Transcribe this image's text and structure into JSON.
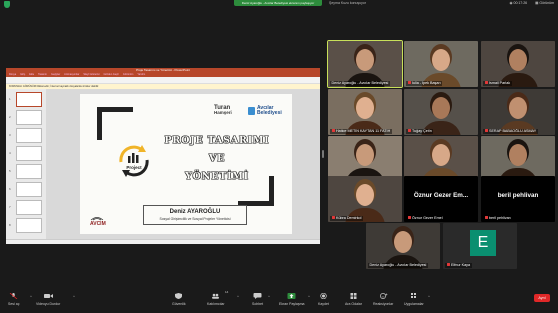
{
  "topbar": {
    "share_banner": "Deniz Ayaroğlu - Avcılar Belediyesi ekranını paylaşıyor",
    "speaking": "Şeyma Kuzu konuşuyor",
    "recording_time": "00:17:26",
    "view_label": "Görünüm"
  },
  "powerpoint": {
    "window_title": "Proje Tasarımı ve Yönetimi - PowerPoint",
    "tabs": [
      "Dosya",
      "Giriş",
      "Ekle",
      "Tasarım",
      "Geçişler",
      "Animasyonlar",
      "Slayt Gösterisi",
      "Gözden Geçir",
      "Görünüm",
      "Yardım"
    ],
    "warning": "KORUMALI GÖRÜNÜM Dikkat edin; İnternet kaynaklı dosyalarda virüsler olabilir.",
    "slide_numbers": [
      "1",
      "2",
      "3",
      "4",
      "5",
      "6",
      "7",
      "8"
    ]
  },
  "slide": {
    "title_lines": [
      "PROJE TASARIMI",
      "VE",
      "YÖNETİMİ"
    ],
    "logo_text": "Project",
    "partner_logo_turan": [
      "Turan",
      "Hamşeri"
    ],
    "partner_logo_avcilar": [
      "Avcılar",
      "Belediyesi"
    ],
    "presenter_name": "Deniz AYAROĞLU",
    "presenter_role": "Sosyal Girişimcilik ve Sosyal Projeler Yöneticisi",
    "org_logo": "AVCIM"
  },
  "gallery": {
    "participants": [
      {
        "name": "Deniz Ayaroğlu - Avcılar Belediyesi",
        "muted": false,
        "active": true
      },
      {
        "name": "Iulia - İpek Başarı",
        "muted": true
      },
      {
        "name": "İsmail Parlak",
        "muted": true
      },
      {
        "name": "Hatice METİN KAYTAN 11 FATİH",
        "muted": true
      },
      {
        "name": "Tuğay Çetin",
        "muted": true
      },
      {
        "name": "SERAP BABAOĞLU ASMAY",
        "muted": true
      },
      {
        "name": "Melissa Karagöz",
        "muted": true
      },
      {
        "name": "esra akgün",
        "muted": true
      },
      {
        "name": "Aysel Öz",
        "muted": true
      },
      {
        "name": "Kübra Demirkol",
        "muted": true
      },
      {
        "name": "Öznur Gezer Emel",
        "muted": true,
        "display_name": "Öznur Gezer Em..."
      },
      {
        "name": "beril pehlivan",
        "muted": true,
        "display_name": "beril pehlivan"
      },
      {
        "name": "Deniz Ayaroğlu - Avcılar Belediyesi",
        "muted": false
      },
      {
        "name": "Elfnur Kaya",
        "muted": true,
        "avatar_letter": "E"
      }
    ]
  },
  "toolbar": {
    "mute": "Sesi aç",
    "video": "Videoyu Durdur",
    "security": "Güvenlik",
    "participants": "Katılımcılar",
    "participants_count": "14",
    "chat": "Sohbet",
    "share": "Ekran Paylaşma",
    "record": "Kaydet",
    "breakout": "Ara Odalar",
    "reactions": "Reaksiyonlar",
    "apps": "Uygulamalar",
    "leave": "Ayrıl"
  },
  "colors": {
    "accent_green": "#2d8c3c",
    "leave_red": "#e02828",
    "powerpoint_red": "#b7472a",
    "avatar_teal": "#0a8f70"
  }
}
